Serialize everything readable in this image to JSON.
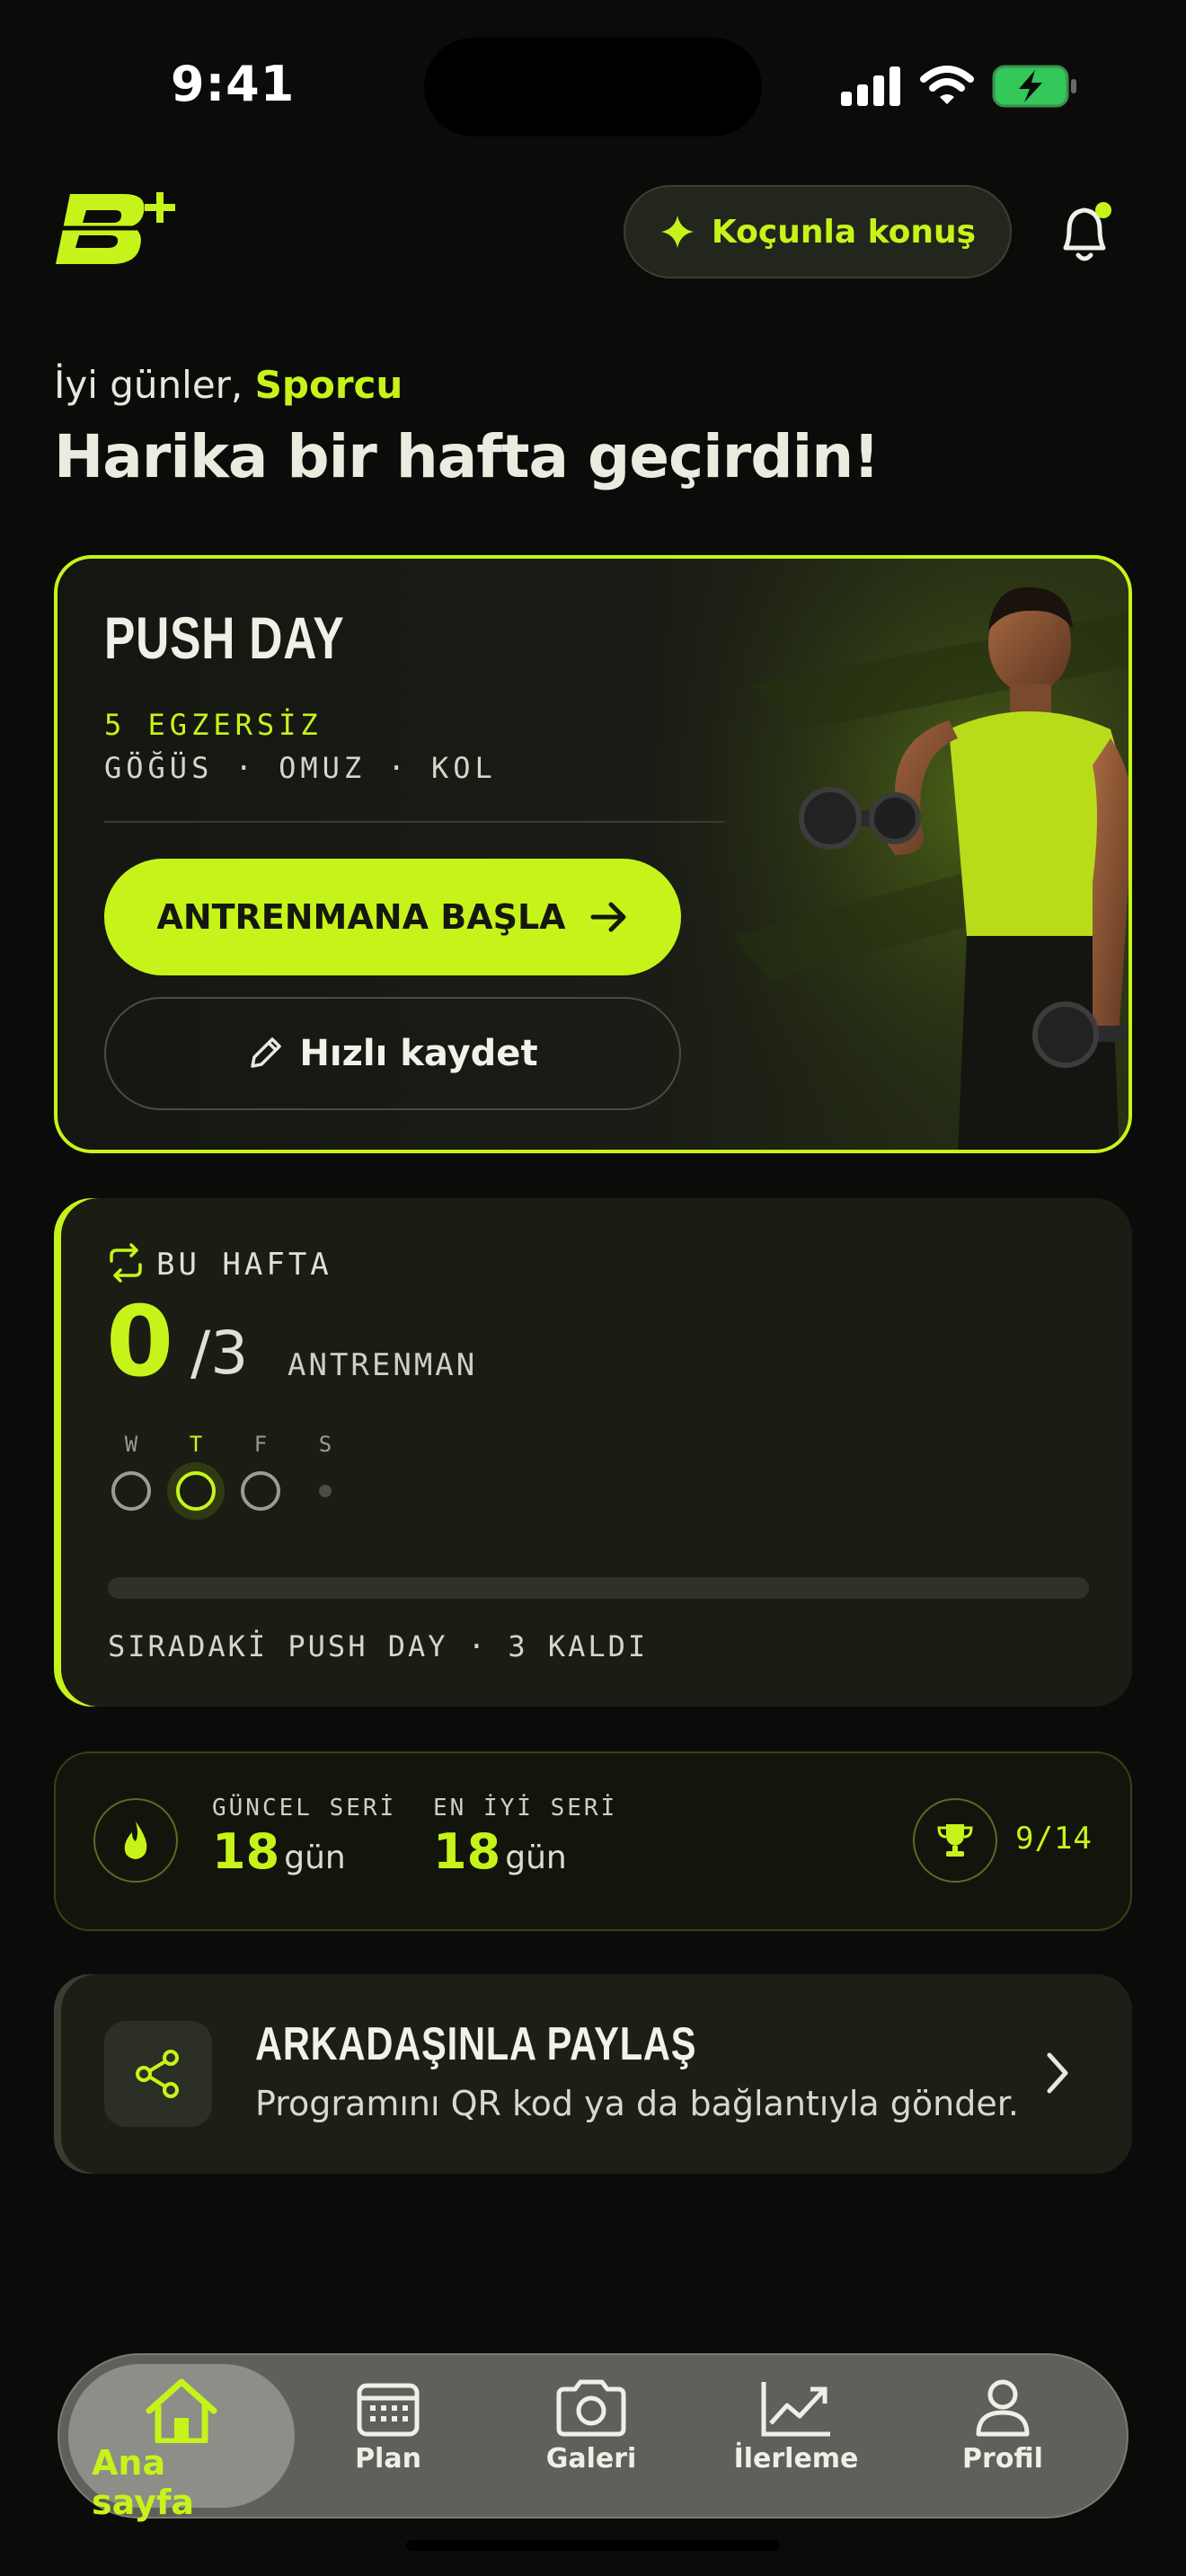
{
  "status_bar": {
    "time": "9:41"
  },
  "header": {
    "coach_button_label": "Koçunla konuş"
  },
  "greeting": {
    "prefix": "İyi günler,",
    "name": "Sporcu",
    "headline": "Harika bir hafta geçirdin!"
  },
  "workout": {
    "title": "PUSH DAY",
    "exercise_count": "5 EGZERSİZ",
    "muscles": "GÖĞÜS · OMUZ · KOL",
    "start_label": "ANTRENMANA BAŞLA",
    "quick_label": "Hızlı kaydet"
  },
  "week": {
    "label": "BU HAFTA",
    "completed": "0",
    "total": "/3",
    "unit": "ANTRENMAN",
    "days": [
      {
        "letter": "W",
        "state": "empty"
      },
      {
        "letter": "T",
        "state": "today"
      },
      {
        "letter": "F",
        "state": "empty"
      },
      {
        "letter": "S",
        "state": "rest"
      }
    ],
    "progress": 0,
    "next": "SIRADAKİ PUSH DAY · 3 KALDI"
  },
  "streak": {
    "current_label": "GÜNCEL SERİ",
    "current_value": "18",
    "current_unit": "gün",
    "best_label": "EN İYİ SERİ",
    "best_value": "18",
    "best_unit": "gün",
    "trophies": "9/14"
  },
  "share": {
    "title": "ARKADAŞINLA PAYLAŞ",
    "subtitle": "Programını QR kod ya da bağlantıyla gönder."
  },
  "tabbar": {
    "items": [
      {
        "label": "Ana sayfa",
        "icon": "home-icon",
        "active": true
      },
      {
        "label": "Plan",
        "icon": "calendar-icon"
      },
      {
        "label": "Galeri",
        "icon": "camera-icon"
      },
      {
        "label": "İlerleme",
        "icon": "chart-icon"
      },
      {
        "label": "Profil",
        "icon": "user-icon"
      }
    ]
  },
  "colors": {
    "accent": "#c6f41a",
    "background": "#0b0c09",
    "card": "#1b1d15"
  }
}
